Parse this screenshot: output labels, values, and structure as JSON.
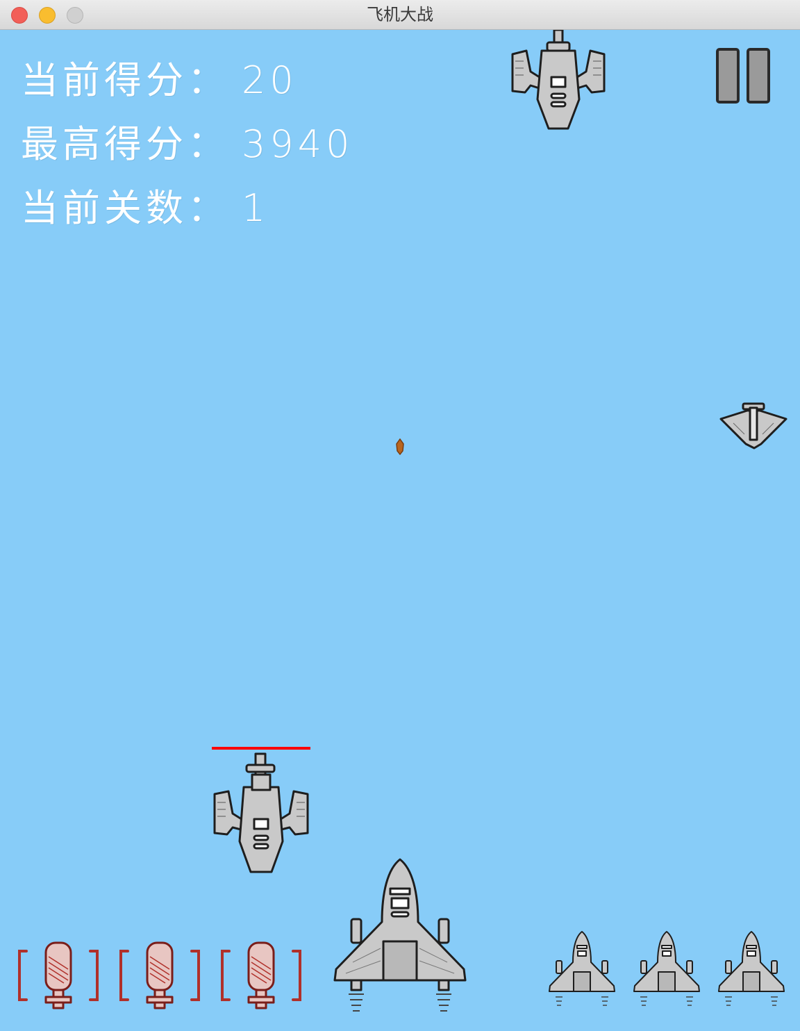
{
  "window": {
    "title": "飞机大战"
  },
  "hud": {
    "score_label": "当前得分：",
    "score_value": "20",
    "high_score_label": "最高得分：",
    "high_score_value": "3940",
    "level_label": "当前关数：",
    "level_value": "1"
  },
  "player": {
    "lives_remaining": 3,
    "bombs_remaining": 3
  },
  "colors": {
    "sky": "#87CCF8",
    "enemy_health_bar": "#ff0000",
    "bomb_red": "#b0302a",
    "aircraft_gray": "#c9c9c9",
    "bullet": "#b8651e"
  },
  "icons": {
    "pause": "pause-icon",
    "bomb": "bomb-icon",
    "life": "life-plane-icon"
  }
}
